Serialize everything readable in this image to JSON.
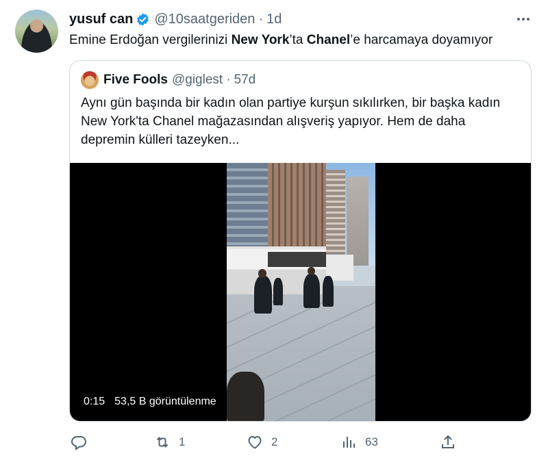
{
  "tweet": {
    "author_name": "yusuf can",
    "handle": "@10saatgeriden",
    "separator": "·",
    "time": "1d",
    "text_parts": [
      "Emine Erdoğan vergilerinizi ",
      "New York",
      "’ta ",
      "Chanel",
      "’e harcamaya doyamıyor"
    ]
  },
  "quote": {
    "author_name": "Five Fools",
    "handle": "@giglest",
    "separator": "·",
    "time": "57d",
    "text": "Aynı gün başında bir kadın olan partiye kurşun sıkılırken, bir başka kadın New York'ta Chanel mağazasından alışveriş yapıyor. Hem de daha depremin külleri tazeyken...",
    "video": {
      "duration": "0:15",
      "views": "53,5 B görüntülenme"
    }
  },
  "actions": {
    "reply_count": "",
    "retweet_count": "1",
    "like_count": "2",
    "views_count": "63"
  },
  "icons": {
    "verified": "verified-badge-icon",
    "more": "more-options-icon",
    "reply": "reply-icon",
    "retweet": "retweet-icon",
    "like": "like-icon",
    "views": "analytics-icon",
    "share": "share-icon"
  },
  "colors": {
    "verified_blue": "#1d9bf0",
    "secondary_text": "#536471",
    "border": "#cfd9de"
  }
}
